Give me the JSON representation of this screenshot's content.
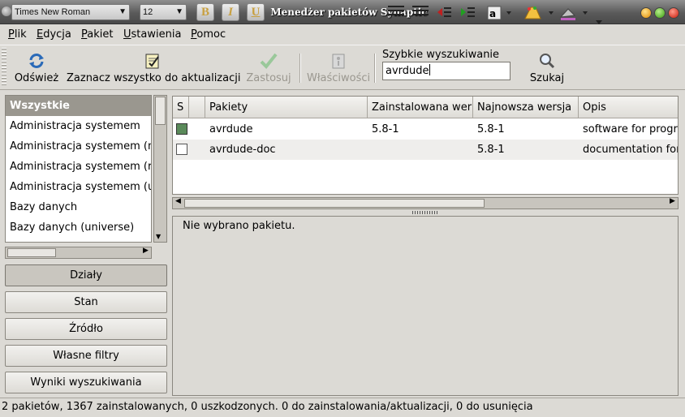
{
  "titlebar": {
    "title": "Menedżer pakietów Synaptic",
    "font_combo": "Times New Roman",
    "size_combo": "12",
    "bold": "B",
    "italic": "I",
    "underline": "U"
  },
  "menu": {
    "items": [
      "Plik",
      "Edycja",
      "Pakiet",
      "Ustawienia",
      "Pomoc"
    ]
  },
  "toolbar": {
    "reload": "Odśwież",
    "mark_upgrades": "Zaznacz wszystko do aktualizacji",
    "apply": "Zastosuj",
    "properties": "Właściwości",
    "quick_search_label": "Szybkie wyszukiwanie",
    "quick_search_value": "avrdude",
    "search": "Szukaj"
  },
  "categories": {
    "items": [
      "Wszystkie",
      "Administracja systemem",
      "Administracja systemem (m",
      "Administracja systemem (r",
      "Administracja systemem (u",
      "Bazy danych",
      "Bazy danych (universe)"
    ],
    "selected_index": 0
  },
  "filters": {
    "sections": "Działy",
    "status": "Stan",
    "origin": "Źródło",
    "custom": "Własne filtry",
    "search_results": "Wyniki wyszukiwania"
  },
  "table": {
    "headers": {
      "s": "S",
      "icon": "",
      "package": "Pakiety",
      "installed": "Zainstalowana wer",
      "latest": "Najnowsza wersja",
      "description": "Opis"
    },
    "rows": [
      {
        "status": "installed",
        "package": "avrdude",
        "installed": "5.8-1",
        "latest": "5.8-1",
        "description": "software for progra"
      },
      {
        "status": "not-installed",
        "package": "avrdude-doc",
        "installed": "",
        "latest": "5.8-1",
        "description": "documentation for"
      }
    ]
  },
  "description": {
    "text": "Nie wybrano pakietu."
  },
  "status": {
    "text": "2 pakietów, 1367 zainstalowanych, 0 uszkodzonych. 0 do zainstalowania/aktualizacji, 0 do usunięcia"
  },
  "colors": {
    "installed_box": "#5a8a5a",
    "selected_category_bg": "#9a978f",
    "window_bg": "#dcdad5"
  }
}
